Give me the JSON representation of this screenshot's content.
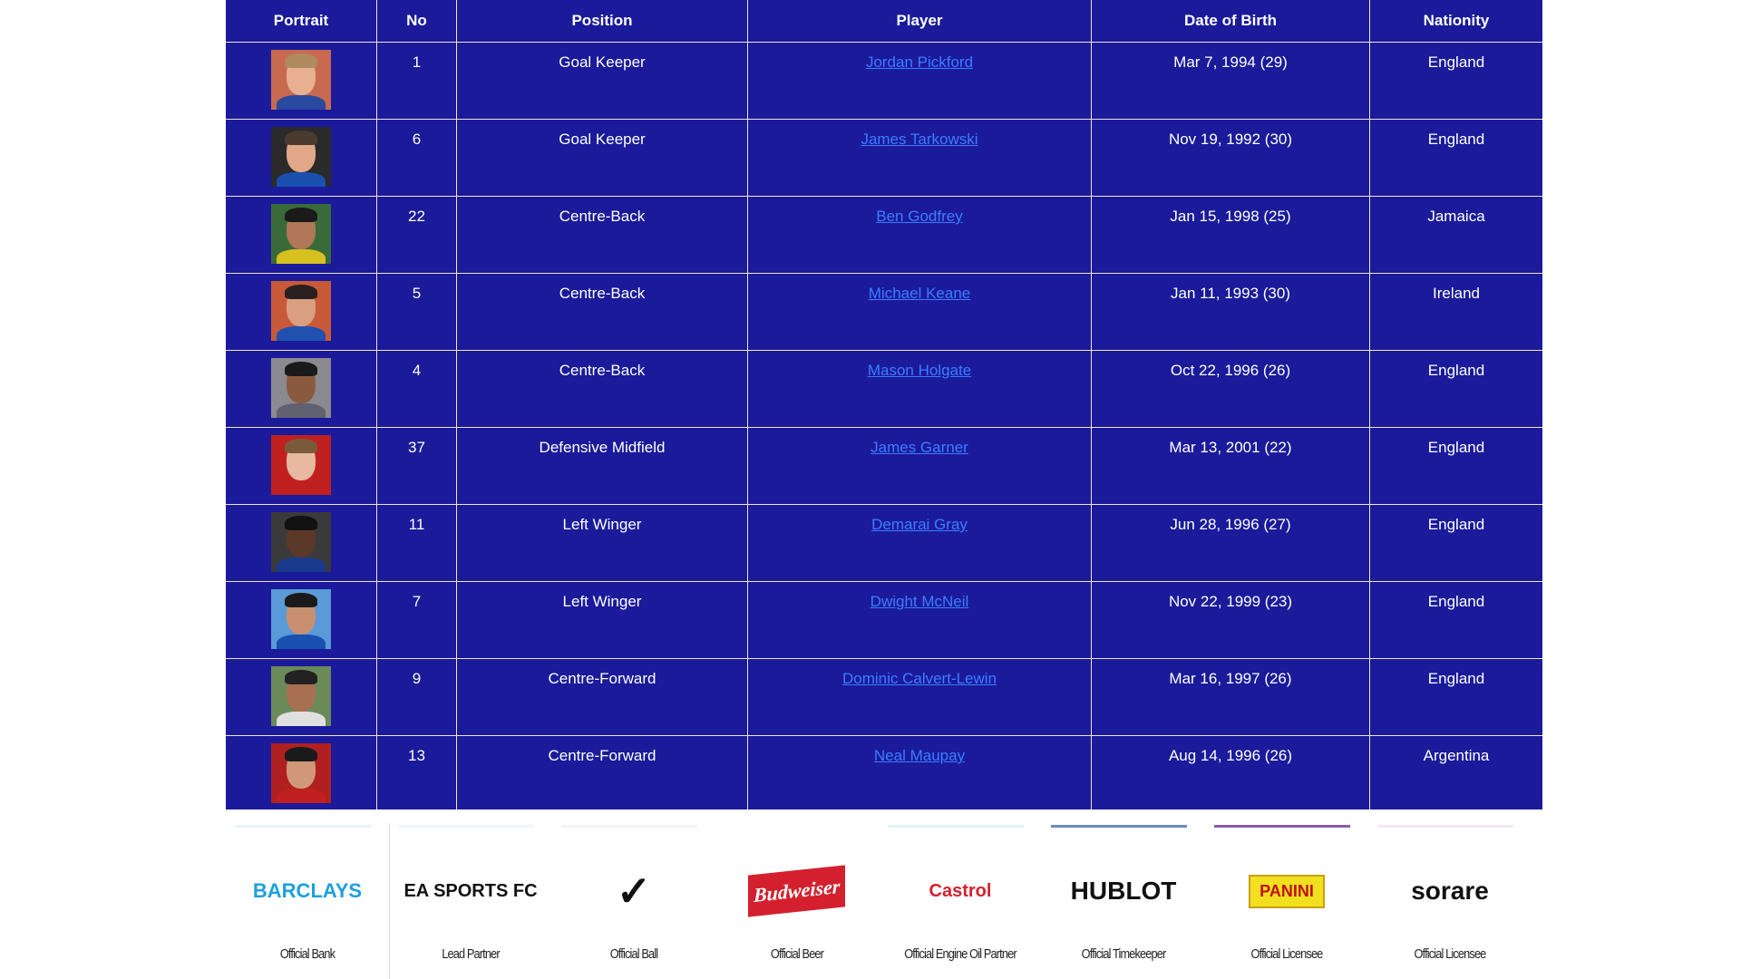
{
  "table": {
    "headers": [
      "Portrait",
      "No",
      "Position",
      "Player",
      "Date of Birth",
      "Nationity"
    ],
    "rows": [
      {
        "no": "1",
        "position": "Goal Keeper",
        "player": "Jordan Pickford",
        "dob": "Mar 7, 1994 (29)",
        "nationality": "England",
        "portrait_bg": "#c86a50",
        "skin": "#e8b090",
        "hair": "#b08a60",
        "shirt": "#2a4aa0"
      },
      {
        "no": "6",
        "position": "Goal Keeper",
        "player": "James Tarkowski",
        "dob": "Nov 19, 1992 (30)",
        "nationality": "England",
        "portrait_bg": "#2a2a2a",
        "skin": "#e0a888",
        "hair": "#4a3a30",
        "shirt": "#1a50b0"
      },
      {
        "no": "22",
        "position": "Centre-Back",
        "player": "Ben Godfrey",
        "dob": "Jan 15, 1998 (25)",
        "nationality": "Jamaica",
        "portrait_bg": "#3a6a3a",
        "skin": "#b07858",
        "hair": "#1a1a1a",
        "shirt": "#d8c020"
      },
      {
        "no": "5",
        "position": "Centre-Back",
        "player": "Michael Keane",
        "dob": "Jan 11, 1993 (30)",
        "nationality": "Ireland",
        "portrait_bg": "#c85a3a",
        "skin": "#d8a080",
        "hair": "#2a2020",
        "shirt": "#2050b0"
      },
      {
        "no": "4",
        "position": "Centre-Back",
        "player": "Mason Holgate",
        "dob": "Oct 22, 1996 (26)",
        "nationality": "England",
        "portrait_bg": "#8a8a90",
        "skin": "#8a5a40",
        "hair": "#1a1a1a",
        "shirt": "#606070"
      },
      {
        "no": "37",
        "position": "Defensive Midfield",
        "player": "James Garner",
        "dob": "Mar 13, 2001 (22)",
        "nationality": "England",
        "portrait_bg": "#c02020",
        "skin": "#e8b8a0",
        "hair": "#7a5a3a",
        "shirt": "#c02020"
      },
      {
        "no": "11",
        "position": "Left Winger",
        "player": "Demarai Gray",
        "dob": "Jun 28, 1996 (27)",
        "nationality": "England",
        "portrait_bg": "#3a3a3a",
        "skin": "#5a3828",
        "hair": "#111111",
        "shirt": "#1a3a90"
      },
      {
        "no": "7",
        "position": "Left Winger",
        "player": "Dwight McNeil",
        "dob": "Nov 22, 1999 (23)",
        "nationality": "England",
        "portrait_bg": "#5a9ad8",
        "skin": "#c89070",
        "hair": "#1a1a1a",
        "shirt": "#1a50b0"
      },
      {
        "no": "9",
        "position": "Centre-Forward",
        "player": "Dominic Calvert-Lewin",
        "dob": "Mar 16, 1997 (26)",
        "nationality": "England",
        "portrait_bg": "#6a8a5a",
        "skin": "#a87050",
        "hair": "#222222",
        "shirt": "#e0e0e0"
      },
      {
        "no": "13",
        "position": "Centre-Forward",
        "player": "Neal Maupay",
        "dob": "Aug 14, 1996 (26)",
        "nationality": "Argentina",
        "portrait_bg": "#b02020",
        "skin": "#d09878",
        "hair": "#1a1a1a",
        "shirt": "#c02020"
      }
    ]
  },
  "sponsors": [
    {
      "logo": "BARCLAYS",
      "caption": "Official Bank",
      "color": "#1ea0dc",
      "bar": "#e8f4fa"
    },
    {
      "logo": "EA SPORTS FC",
      "caption": "Lead Partner",
      "color": "#111111",
      "bar": "#eef6f8"
    },
    {
      "logo": "✓",
      "caption": "Official Ball",
      "color": "#111111",
      "bar": "#f2f4f6"
    },
    {
      "logo": "Budweiser",
      "caption": "Official Beer",
      "color": "#d4202e",
      "bar": "#ffffff"
    },
    {
      "logo": "Castrol",
      "caption": "Official Engine Oil Partner",
      "color": "#d4202e",
      "bar": "#dff4f6"
    },
    {
      "logo": "HUBLOT",
      "caption": "Official Timekeeper",
      "color": "#111111",
      "bar": "#6a8ab8"
    },
    {
      "logo": "PANINI",
      "caption": "Official Licensee",
      "color": "#c01010",
      "bar": "#8a5ab0"
    },
    {
      "logo": "sorare",
      "caption": "Official Licensee",
      "color": "#111111",
      "bar": "#f6e8f6"
    }
  ]
}
